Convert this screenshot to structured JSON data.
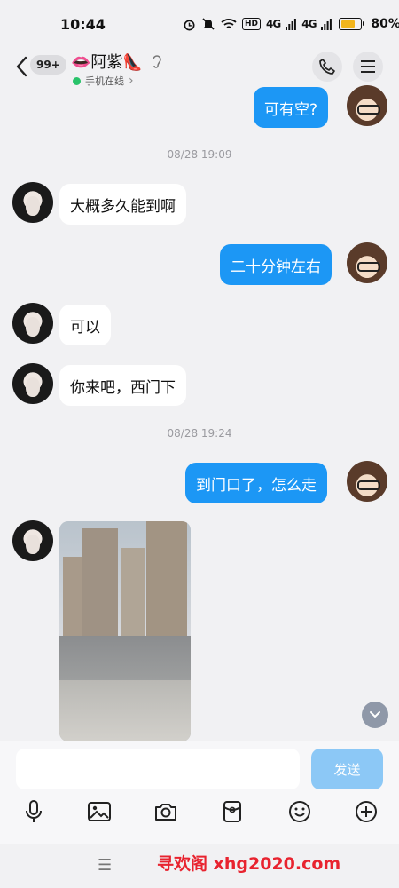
{
  "status_bar": {
    "time": "10:44",
    "battery": "80%",
    "battery_level": 0.8,
    "hd_label": "HD",
    "signal_1": "4G",
    "signal_2": "4G"
  },
  "header": {
    "unread_count": "99+",
    "contact_name": "👄阿紫👠",
    "online_status": "手机在线",
    "online_chevron": "›"
  },
  "messages": [
    {
      "side": "out",
      "text": "可有空?"
    },
    {
      "timestamp": "08/28 19:09"
    },
    {
      "side": "in",
      "text": "大概多久能到啊"
    },
    {
      "side": "out",
      "text": "二十分钟左右"
    },
    {
      "side": "in",
      "text": "可以"
    },
    {
      "side": "in",
      "text": "你来吧，西门下"
    },
    {
      "timestamp": "08/28 19:24"
    },
    {
      "side": "out",
      "text": "到门口了，怎么走"
    },
    {
      "side": "in",
      "type": "photo"
    }
  ],
  "input": {
    "value": "",
    "send_label": "发送"
  },
  "toolbar": [
    "microphone-icon",
    "image-icon",
    "camera-icon",
    "red-packet-icon",
    "emoji-icon",
    "plus-icon"
  ],
  "nav": {
    "menu_glyph": "☰"
  },
  "watermark": "寻欢阁 xhg2020.com",
  "colors": {
    "outgoing_bubble": "#1c97f5",
    "incoming_bubble": "#ffffff",
    "background": "#f1f1f3",
    "send_button_disabled": "#8cc8f6",
    "online_dot": "#29c36a",
    "battery_fill": "#f2b51c",
    "watermark": "#e8232f"
  }
}
